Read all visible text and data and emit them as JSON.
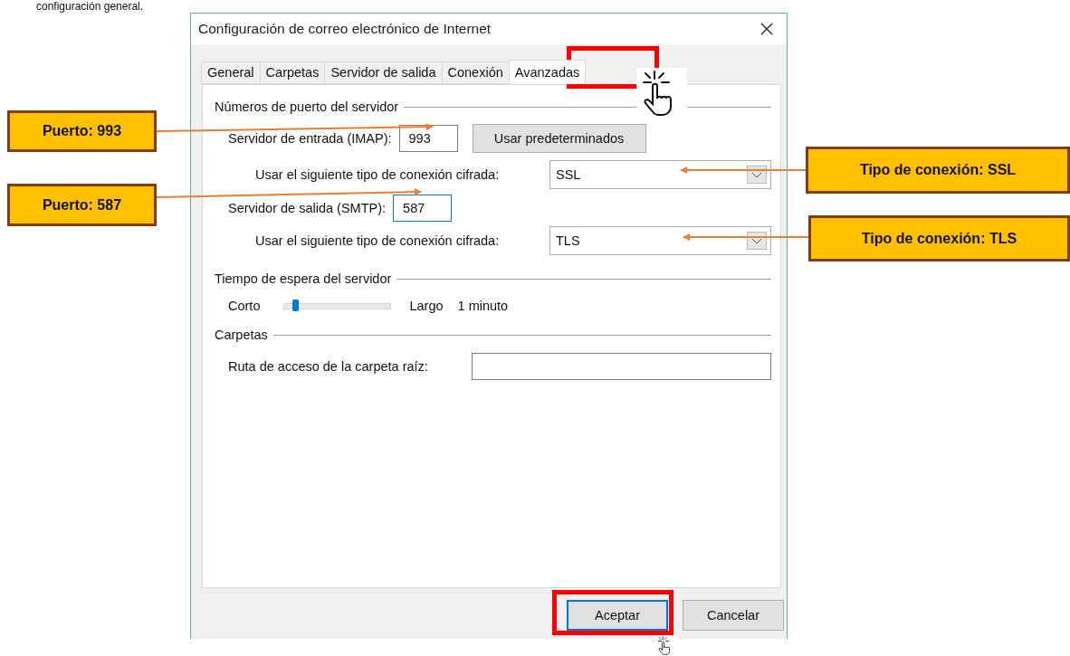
{
  "intro_text": "configuración general.",
  "dialog": {
    "title": "Configuración de correo electrónico de Internet",
    "tabs": [
      {
        "label": "General",
        "selected": false
      },
      {
        "label": "Carpetas",
        "selected": false
      },
      {
        "label": "Servidor de salida",
        "selected": false
      },
      {
        "label": "Conexión",
        "selected": false
      },
      {
        "label": "Avanzadas",
        "selected": true
      }
    ],
    "ports_section": {
      "heading": "Números de puerto del servidor",
      "incoming": {
        "label": "Servidor de entrada (IMAP):",
        "value": "993",
        "focused": false
      },
      "defaults_button": "Usar predeterminados",
      "incoming_encryption": {
        "label": "Usar el siguiente tipo de conexión cifrada:",
        "value": "SSL"
      },
      "outgoing": {
        "label": "Servidor de salida (SMTP):",
        "value": "587",
        "focused": true
      },
      "outgoing_encryption": {
        "label": "Usar el siguiente tipo de conexión cifrada:",
        "value": "TLS"
      }
    },
    "timeout_section": {
      "heading": "Tiempo de espera del servidor",
      "short_label": "Corto",
      "level": 0.1,
      "long_label": "Largo",
      "reading": "1 minuto"
    },
    "folders_section": {
      "heading": "Carpetas",
      "root_path_label": "Ruta de acceso de la carpeta raíz:"
    },
    "buttons": [
      {
        "label": "Aceptar",
        "default": true
      },
      {
        "label": "Cancelar",
        "default": false
      }
    ]
  },
  "annotations": [
    {
      "label": "Puerto: 993"
    },
    {
      "label": "Puerto: 587"
    },
    {
      "label": "Tipo de conexión: SSL"
    },
    {
      "label": "Tipo de conexión: TLS"
    }
  ]
}
